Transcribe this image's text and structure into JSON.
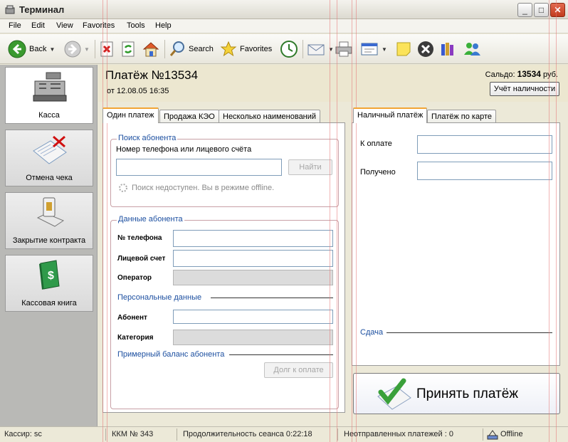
{
  "window": {
    "title": "Терминал",
    "minimize": "_",
    "maximize": "□",
    "close": "✕"
  },
  "menu": [
    "File",
    "Edit",
    "View",
    "Favorites",
    "Tools",
    "Help"
  ],
  "toolbar": {
    "back": "Back",
    "search": "Search",
    "favorites": "Favorites"
  },
  "sidebar": {
    "items": [
      {
        "label": "Касса",
        "icon": "cash-register-icon"
      },
      {
        "label": "Отмена чека",
        "icon": "cancel-receipt-icon"
      },
      {
        "label": "Закрытие контракта",
        "icon": "close-contract-icon"
      },
      {
        "label": "Кассовая книга",
        "icon": "cash-book-icon"
      }
    ]
  },
  "header": {
    "title": "Платёж №13534",
    "date": "от 12.08.05 16:35",
    "balance_label": "Сальдо:",
    "balance_value": "13534",
    "balance_unit": "руб.",
    "cash_button": "Учёт наличности"
  },
  "left_tabs": [
    "Один платеж",
    "Продажа КЭО",
    "Несколько наименований"
  ],
  "search_group": {
    "title": "Поиск абонента",
    "prompt": "Номер телефона или лицевого счёта",
    "find_button": "Найти",
    "offline_note": "Поиск недоступен. Вы в режиме offline."
  },
  "subscriber": {
    "title": "Данные абонента",
    "phone_label": "№ телефона",
    "account_label": "Лицевой счет",
    "operator_label": "Оператор",
    "personal_title": "Персональные данные",
    "subscriber_label": "Абонент",
    "category_label": "Категория",
    "balance_title": "Примерный баланс абонента",
    "debt_button": "Долг к оплате"
  },
  "right_tabs": [
    "Наличный платёж",
    "Платёж по карте"
  ],
  "cash_payment": {
    "to_pay_label": "К оплате",
    "received_label": "Получено",
    "change_label": "Сдача"
  },
  "accept_button": "Принять платёж",
  "status": {
    "cashier": "Кассир: sc",
    "kkm": "ККМ № 343",
    "session": "Продолжительность сеанса 0:22:18",
    "unsent": "Неотправленных платежей : 0",
    "mode": "Offline"
  },
  "colors": {
    "accent": "#1c4fa0",
    "header_bg": "#ece7d0",
    "sidebar_bg": "#b9b9b6",
    "tab_highlight": "#f2a535"
  }
}
